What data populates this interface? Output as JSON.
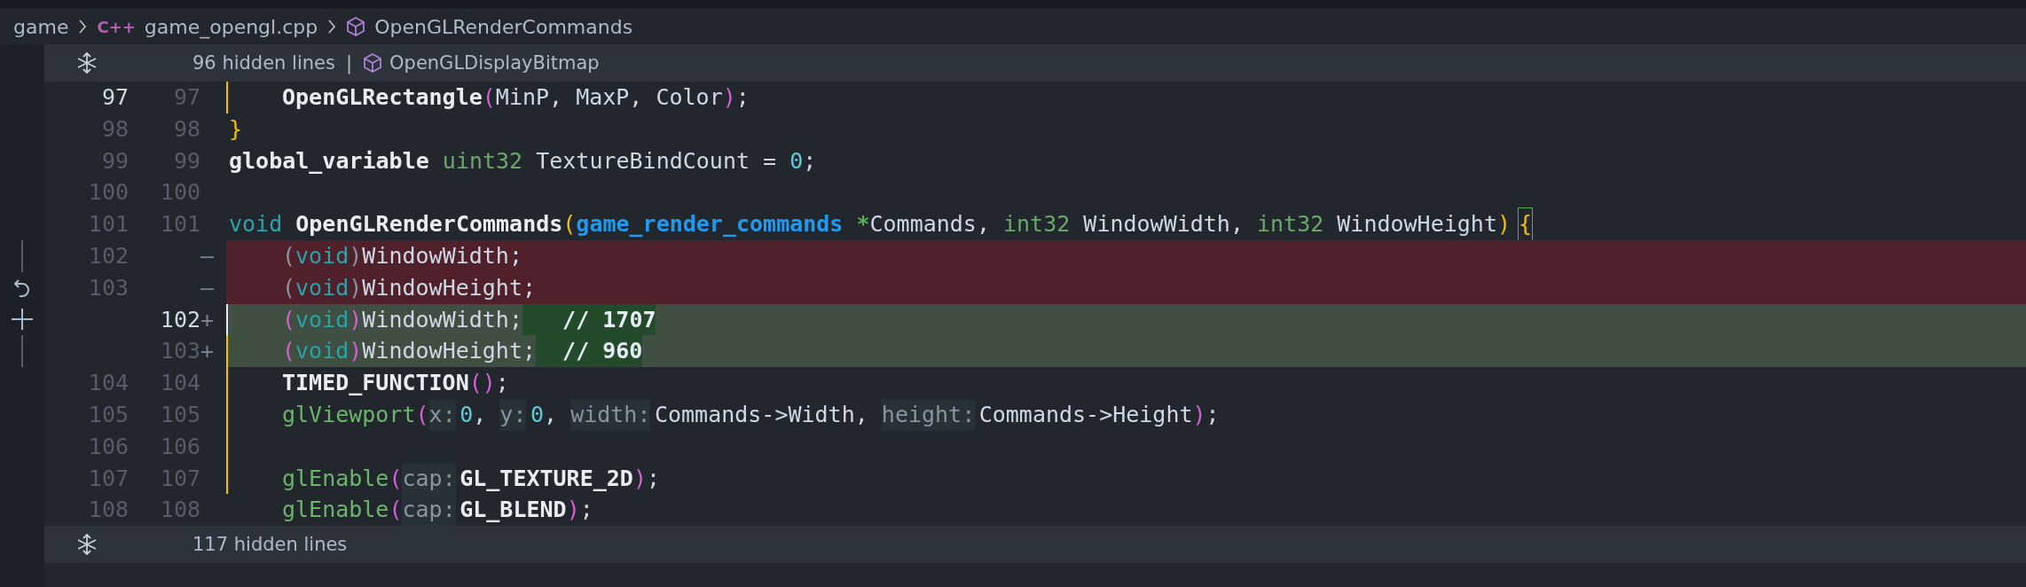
{
  "breadcrumbs": {
    "folder": "game",
    "lang_badge": "C++",
    "file": "game_opengl.cpp",
    "symbol": "OpenGLRenderCommands"
  },
  "fold_top": {
    "label": "96 hidden lines",
    "separator": "|",
    "symbol": "OpenGLDisplayBitmap"
  },
  "lines": [
    {
      "old": "97",
      "new": "97",
      "kind": "context",
      "active": true,
      "indented": true,
      "guide": true,
      "tokens": [
        {
          "kind": "fn",
          "text": "OpenGLRectangle"
        },
        {
          "kind": "paren",
          "text": "("
        },
        {
          "kind": "plain",
          "text": "MinP, MaxP, Color"
        },
        {
          "kind": "paren",
          "text": ")"
        },
        {
          "kind": "plain",
          "text": ";"
        }
      ]
    },
    {
      "old": "98",
      "new": "98",
      "kind": "context",
      "active": false,
      "indented": false,
      "guide": false,
      "tokens": [
        {
          "kind": "brace",
          "text": "}"
        }
      ]
    },
    {
      "old": "99",
      "new": "99",
      "kind": "context",
      "active": false,
      "indented": false,
      "guide": false,
      "tokens": [
        {
          "kind": "fn",
          "text": "global_variable"
        },
        {
          "kind": "type",
          "text": " uint32"
        },
        {
          "kind": "plain",
          "text": " TextureBindCount = "
        },
        {
          "kind": "num",
          "text": "0"
        },
        {
          "kind": "plain",
          "text": ";"
        }
      ]
    },
    {
      "old": "100",
      "new": "100",
      "kind": "context",
      "active": false,
      "indented": false,
      "guide": false
    },
    {
      "old": "101",
      "new": "101",
      "kind": "context",
      "active": false,
      "indented": false,
      "guide": false,
      "tokens": [
        {
          "kind": "kw",
          "text": "void"
        },
        {
          "kind": "fn",
          "text": " OpenGLRenderCommands"
        },
        {
          "kind": "brace",
          "text": "("
        },
        {
          "kind": "ptype",
          "text": "game_render_commands"
        },
        {
          "kind": "ptr",
          "text": " *"
        },
        {
          "kind": "plain",
          "text": "Commands, "
        },
        {
          "kind": "type",
          "text": "int32"
        },
        {
          "kind": "plain",
          "text": " WindowWidth, "
        },
        {
          "kind": "type",
          "text": "int32"
        },
        {
          "kind": "plain",
          "text": " WindowHeight"
        },
        {
          "kind": "brace",
          "text": ")"
        },
        {
          "kind": "bracebox",
          "text": "{"
        }
      ]
    },
    {
      "old": "102",
      "sign": "—",
      "kind": "deleted",
      "active": false,
      "indented": true,
      "guide": false,
      "tokens": [
        {
          "kind": "punct",
          "text": "("
        },
        {
          "kind": "kw",
          "text": "void"
        },
        {
          "kind": "punct",
          "text": ")"
        },
        {
          "kind": "plain",
          "text": "WindowWidth;"
        }
      ]
    },
    {
      "old": "103",
      "sign": "—",
      "kind": "deleted",
      "active": false,
      "indented": true,
      "guide": false,
      "tokens": [
        {
          "kind": "punct",
          "text": "("
        },
        {
          "kind": "kw",
          "text": "void"
        },
        {
          "kind": "punct",
          "text": ")"
        },
        {
          "kind": "plain",
          "text": "WindowHeight;"
        }
      ]
    },
    {
      "new": "102",
      "sign": "+",
      "kind": "added",
      "active": true,
      "indented": true,
      "guide": true,
      "tokens": [
        {
          "kind": "paren",
          "text": "("
        },
        {
          "kind": "kw",
          "text": "void"
        },
        {
          "kind": "paren",
          "text": ")"
        },
        {
          "kind": "plain",
          "text": "WindowWidth;"
        },
        {
          "kind": "inserted",
          "text": "   // 1707"
        }
      ]
    },
    {
      "new": "103",
      "sign": "+",
      "kind": "added",
      "active": false,
      "indented": true,
      "guide": true,
      "tokens": [
        {
          "kind": "paren",
          "text": "("
        },
        {
          "kind": "kw",
          "text": "void"
        },
        {
          "kind": "paren",
          "text": ")"
        },
        {
          "kind": "plain",
          "text": "WindowHeight;"
        },
        {
          "kind": "inserted",
          "text": "  // 960"
        }
      ]
    },
    {
      "old": "104",
      "new": "104",
      "kind": "context",
      "active": false,
      "indented": true,
      "guide": true,
      "tokens": [
        {
          "kind": "macro",
          "text": "TIMED_FUNCTION"
        },
        {
          "kind": "paren",
          "text": "()"
        },
        {
          "kind": "plain",
          "text": ";"
        }
      ]
    },
    {
      "old": "105",
      "new": "105",
      "kind": "context",
      "active": false,
      "indented": true,
      "guide": true,
      "tokens": [
        {
          "kind": "call",
          "text": "glViewport"
        },
        {
          "kind": "paren",
          "text": "("
        },
        {
          "kind": "hint",
          "text": "x:"
        },
        {
          "kind": "num",
          "text": "0"
        },
        {
          "kind": "plain",
          "text": ", "
        },
        {
          "kind": "hint",
          "text": "y:"
        },
        {
          "kind": "num",
          "text": "0"
        },
        {
          "kind": "plain",
          "text": ", "
        },
        {
          "kind": "hint",
          "text": "width:"
        },
        {
          "kind": "plain",
          "text": "Commands->Width, "
        },
        {
          "kind": "hint",
          "text": "height:"
        },
        {
          "kind": "plain",
          "text": "Commands->Height"
        },
        {
          "kind": "paren",
          "text": ")"
        },
        {
          "kind": "plain",
          "text": ";"
        }
      ]
    },
    {
      "old": "106",
      "new": "106",
      "kind": "context",
      "active": false,
      "indented": false,
      "guide": true
    },
    {
      "old": "107",
      "new": "107",
      "kind": "context",
      "active": false,
      "indented": true,
      "guide": true,
      "tokens": [
        {
          "kind": "call",
          "text": "glEnable"
        },
        {
          "kind": "paren",
          "text": "("
        },
        {
          "kind": "hint",
          "text": "cap:"
        },
        {
          "kind": "macro",
          "text": "GL_TEXTURE_2D"
        },
        {
          "kind": "paren",
          "text": ")"
        },
        {
          "kind": "plain",
          "text": ";"
        }
      ]
    },
    {
      "old": "108",
      "new": "108",
      "kind": "context",
      "active": false,
      "indented": true,
      "guide": false,
      "tokens": [
        {
          "kind": "call",
          "text": "glEnable"
        },
        {
          "kind": "paren",
          "text": "("
        },
        {
          "kind": "hint",
          "text": "cap:"
        },
        {
          "kind": "macro",
          "text": "GL_BLEND"
        },
        {
          "kind": "paren",
          "text": ")"
        },
        {
          "kind": "plain",
          "text": ";"
        }
      ]
    }
  ],
  "fold_bottom": {
    "label": "117 hidden lines"
  }
}
